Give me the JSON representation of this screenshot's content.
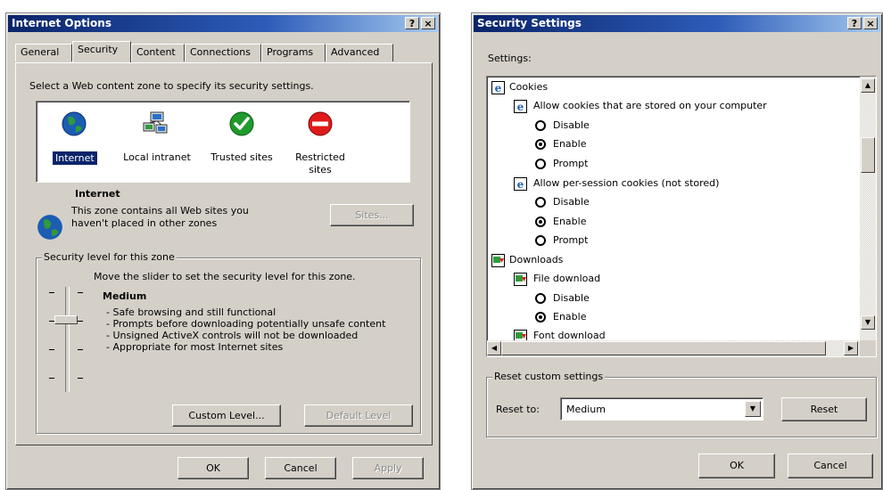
{
  "internet_options": {
    "title": "Internet Options",
    "help_btn": "?",
    "close_btn": "×",
    "tabs": [
      "General",
      "Security",
      "Content",
      "Connections",
      "Programs",
      "Advanced"
    ],
    "active_tab": "Security",
    "zone_prompt": "Select a Web content zone to specify its security settings.",
    "zones": [
      {
        "label": "Internet",
        "icon": "globe-icon"
      },
      {
        "label": "Local intranet",
        "icon": "network-icon"
      },
      {
        "label": "Trusted sites",
        "icon": "check-icon"
      },
      {
        "label": "Restricted sites",
        "icon": "no-entry-icon"
      }
    ],
    "selected_zone_title": "Internet",
    "selected_zone_desc_1": "This zone contains all Web sites you",
    "selected_zone_desc_2": "haven't placed in other zones",
    "sites_btn": "Sites...",
    "security_group_label": "Security level for this zone",
    "slider_instruction": "Move the slider to set the security level for this zone.",
    "level_name": "Medium",
    "level_desc": [
      "- Safe browsing and still functional",
      "- Prompts before downloading potentially unsafe content",
      "- Unsigned ActiveX controls will not be downloaded",
      "- Appropriate for most Internet sites"
    ],
    "custom_level_btn": "Custom Level...",
    "default_level_btn": "Default Level",
    "ok_btn": "OK",
    "cancel_btn": "Cancel",
    "apply_btn": "Apply"
  },
  "security_settings": {
    "title": "Security Settings",
    "help_btn": "?",
    "close_btn": "×",
    "settings_label": "Settings:",
    "tree": {
      "cookies": "Cookies",
      "allow_stored": "Allow cookies that are stored on your computer",
      "allow_session": "Allow per-session cookies (not stored)",
      "downloads": "Downloads",
      "file_download": "File download",
      "font_download": "Font download",
      "disable": "Disable",
      "enable": "Enable",
      "prompt": "Prompt"
    },
    "reset_group_label": "Reset custom settings",
    "reset_to_label": "Reset to:",
    "reset_to_value": "Medium",
    "reset_btn": "Reset",
    "ok_btn": "OK",
    "cancel_btn": "Cancel"
  }
}
